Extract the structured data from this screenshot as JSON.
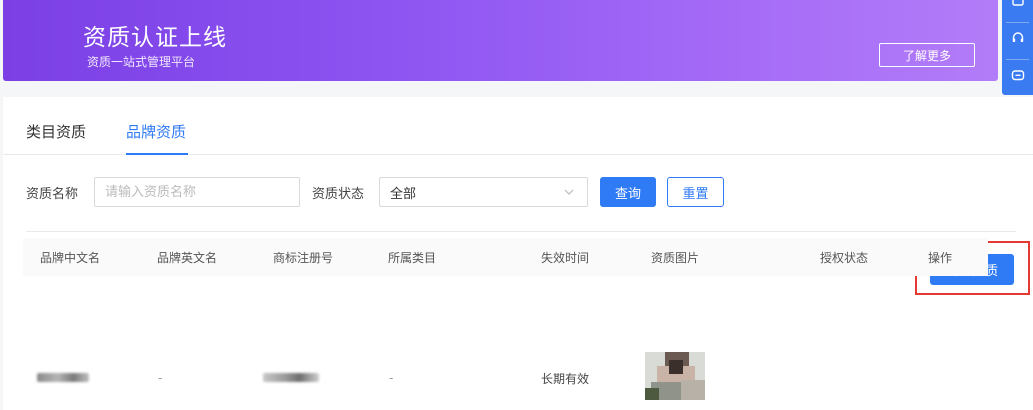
{
  "banner": {
    "title": "资质认证上线",
    "subtitle": "资质一站式管理平台",
    "more_label": "了解更多",
    "gradient_start": "#7b3fe4",
    "gradient_end": "#b27cf8"
  },
  "float_bar": {
    "color": "#3a7bf2",
    "items": [
      {
        "icon": "window-icon"
      },
      {
        "icon": "headset-icon"
      },
      {
        "icon": "chat-icon"
      }
    ]
  },
  "tabs": [
    {
      "label": "类目资质",
      "active": false
    },
    {
      "label": "品牌资质",
      "active": true
    }
  ],
  "filters": {
    "name_label": "资质名称",
    "name_placeholder": "请输入资质名称",
    "status_label": "资质状态",
    "status_value": "全部",
    "query_label": "查询",
    "reset_label": "重置"
  },
  "actions": {
    "new_label": "新建资质"
  },
  "table": {
    "columns": [
      "品牌中文名",
      "品牌英文名",
      "商标注册号",
      "所属类目",
      "失效时间",
      "资质图片",
      "授权状态",
      "操作"
    ],
    "rows": [
      {
        "brand_cn": "",
        "brand_en": "-",
        "trademark_no": "",
        "category": "-",
        "expiry": "长期有效",
        "image": "qualification-thumbnail",
        "auth_status": "",
        "operation": ""
      }
    ]
  },
  "colors": {
    "accent": "#2f7af5",
    "highlight": "#e53935"
  }
}
